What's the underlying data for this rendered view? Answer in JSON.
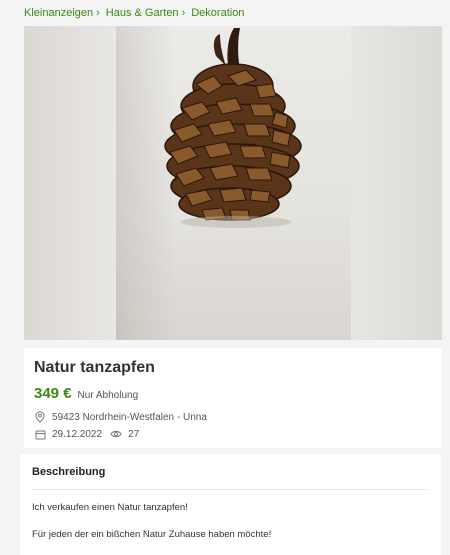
{
  "breadcrumb": {
    "items": [
      "Kleinanzeigen",
      "Haus & Garten",
      "Dekoration"
    ]
  },
  "gallery": {
    "image_subject": "pine cone photo"
  },
  "listing": {
    "title": "Natur tanzapfen",
    "price": "349 €",
    "pickup": "Nur Abholung",
    "location": "59423 Nordrhein-Westfalen - Unna",
    "date": "29.12.2022",
    "views": "27"
  },
  "description": {
    "heading": "Beschreibung",
    "line1": "Ich verkaufen einen Natur tanzapfen!",
    "line2": "Für jeden der ein bißchen Natur Zuhause haben möchte!"
  },
  "colors": {
    "accent": "#3a8a10",
    "background": "#f4f4f4",
    "card": "#ffffff"
  },
  "icons": [
    "chevron-right-icon",
    "location-pin-icon",
    "calendar-icon",
    "eye-icon"
  ]
}
